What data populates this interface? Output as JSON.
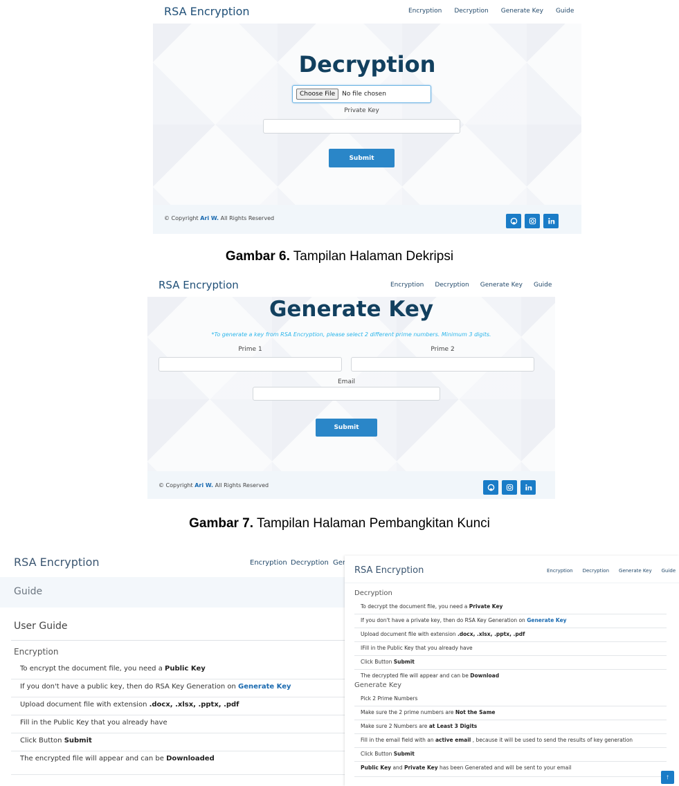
{
  "brand": "RSA Encryption",
  "nav": [
    "Encryption",
    "Decryption",
    "Generate Key",
    "Guide"
  ],
  "footer": {
    "prefix": "© Copyright",
    "author": "Ari W.",
    "suffix": "All Rights Reserved"
  },
  "social_icons": [
    "github-icon",
    "instagram-icon",
    "linkedin-icon"
  ],
  "colors": {
    "brand": "#1f4f77",
    "title": "#12405f",
    "button": "#2a86c8",
    "social": "#1a7cc7",
    "hint": "#2bb5ea",
    "link": "#1a6ab0"
  },
  "decryption_page": {
    "title": "Decryption",
    "file_button": "Choose File",
    "file_status": "No file chosen",
    "private_key_label": "Private Key",
    "private_key_value": "",
    "submit": "Submit"
  },
  "caption6": {
    "label": "Gambar 6.",
    "text": "Tampilan Halaman Dekripsi"
  },
  "genkey_page": {
    "title": "Generate Key",
    "hint": "*To generate a key from RSA Encryption, please select 2 different prime numbers. Minimum 3 digits.",
    "prime1_label": "Prime 1",
    "prime2_label": "Prime 2",
    "email_label": "Email",
    "submit": "Submit"
  },
  "caption7": {
    "label": "Gambar 7.",
    "text": "Tampilan Halaman Pembangkitan Kunci"
  },
  "guide_left": {
    "nav_visible": [
      "Encryption",
      "Decryption",
      "Gen"
    ],
    "page_header": "Guide",
    "heading": "User Guide",
    "section": "Encryption",
    "items": [
      [
        "To encrypt the document file, you need a ",
        "Public Key",
        ""
      ],
      [
        "If you don't have a public key, then do RSA Key Generation on ",
        "Generate Key",
        ""
      ],
      [
        "Upload document file with extension ",
        ".docx, .xlsx, .pptx, .pdf",
        ""
      ],
      [
        "Fill in the Public Key that you already have",
        "",
        ""
      ],
      [
        "Click Button ",
        "Submit",
        ""
      ],
      [
        "The encrypted file will appear and can be ",
        "Downloaded",
        ""
      ]
    ]
  },
  "guide_right": {
    "decryption_title": "Decryption",
    "decryption_items": [
      [
        "To decrypt the document file, you need a ",
        "Private Key",
        ""
      ],
      [
        "If you don't have a private key, then do RSA Key Generation on ",
        "Generate Key",
        ""
      ],
      [
        "Upload document file with extension ",
        ".docx, .xlsx, .pptx, .pdf",
        ""
      ],
      [
        "IFill in the Public Key that you already have",
        "",
        ""
      ],
      [
        "Click Button ",
        "Submit",
        ""
      ],
      [
        "The decrypted file will appear and can be ",
        "Download",
        ""
      ]
    ],
    "genkey_title": "Generate Key",
    "genkey_items": [
      [
        "Pick 2 Prime Numbers",
        "",
        ""
      ],
      [
        "Make sure the 2 prime numbers are ",
        "Not the Same",
        ""
      ],
      [
        "Make sure 2 Numbers are ",
        "at Least 3 Digits",
        ""
      ],
      [
        "Fill in the email field with an ",
        "active email",
        " , because it will be used to send the results of key generation"
      ],
      [
        "Click Button ",
        "Submit",
        ""
      ],
      [
        "",
        "Public Key",
        " and "
      ],
      [
        "",
        "Private Key",
        " has been Generated and will be sent to your email"
      ]
    ],
    "scroll_top": "↑"
  }
}
